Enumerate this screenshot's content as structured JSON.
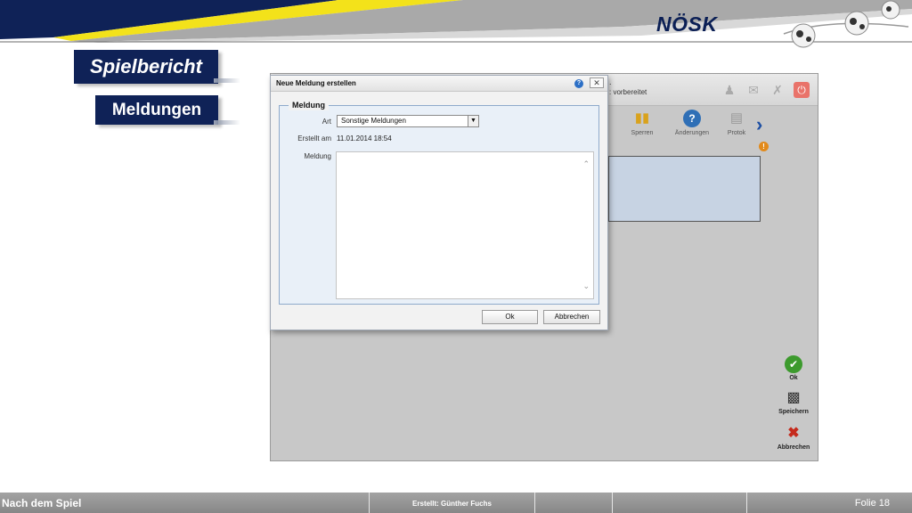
{
  "brand": {
    "logo": "NÖSK",
    "colors": {
      "navy": "#0f2257",
      "yellow": "#f3e21a",
      "grey": "#8e8e8e",
      "accent_blue": "#1e4fa3"
    }
  },
  "slide": {
    "title": "Spielbericht",
    "subtitle": "Meldungen"
  },
  "app": {
    "status_prefix": ".",
    "status_text": ": vorbereitet",
    "top_icons": [
      "user-icon",
      "mail-icon",
      "tools-icon",
      "power-icon"
    ],
    "toolbar": [
      {
        "label": "Sperren",
        "icon": "cards-icon"
      },
      {
        "label": "Änderungen",
        "icon": "help-icon"
      },
      {
        "label": "Protok",
        "icon": "document-icon"
      }
    ],
    "side_buttons": {
      "ok": "Ok",
      "save": "Speichern",
      "cancel": "Abbrechen"
    }
  },
  "dialog": {
    "title": "Neue Meldung erstellen",
    "legend": "Meldung",
    "art_label": "Art",
    "art_value": "Sonstige Meldungen",
    "erstellt_label": "Erstellt am",
    "erstellt_value": "11.01.2014 18:54",
    "meldung_label": "Meldung",
    "meldung_value": "",
    "ok_label": "Ok",
    "cancel_label": "Abbrechen"
  },
  "footer": {
    "section": "Nach dem Spiel",
    "author": "Erstellt: Günther Fuchs",
    "slide_label": "Folie  18"
  }
}
